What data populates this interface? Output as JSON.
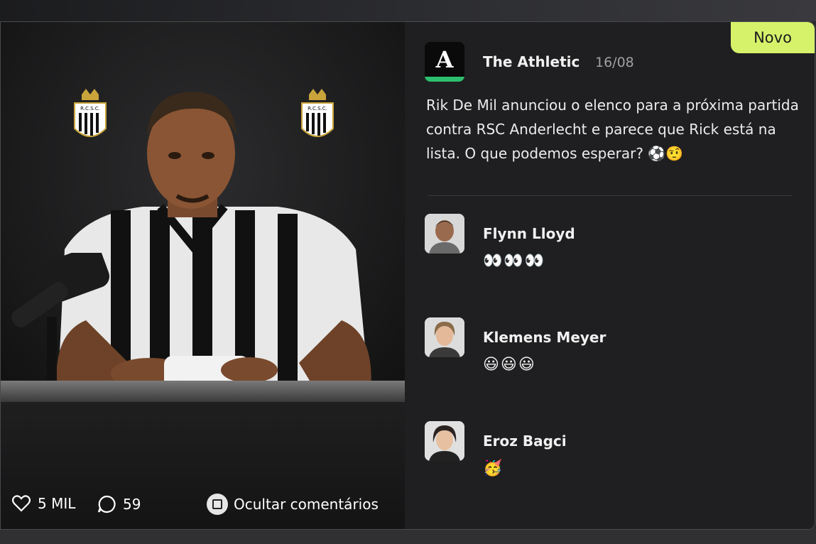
{
  "post": {
    "badge": "Novo",
    "source": "The Athletic",
    "source_logo_letter": "A",
    "date": "16/08",
    "text": "Rik De Mil anunciou o elenco para a próxima partida contra RSC Anderlecht e parece que Rick está na lista. O que podemos esperar? ⚽🤨"
  },
  "media": {
    "crest_text": "R.C.S.C.",
    "likes": "5 MIL",
    "comments_count": "59",
    "hide_comments_label": "Ocultar comentários"
  },
  "comments": [
    {
      "name": "Flynn Lloyd",
      "text": "👀👀👀"
    },
    {
      "name": "Klemens Meyer",
      "text": "😃😃😃"
    },
    {
      "name": "Eroz Bagci",
      "text": "🥳"
    }
  ],
  "colors": {
    "badge": "#d6f26b",
    "athletic_green": "#2dbd6e",
    "background": "#1f1f21"
  },
  "icons": {
    "likes": "heart-icon",
    "comments": "speech-bubble-icon",
    "hide": "square-button-icon"
  }
}
